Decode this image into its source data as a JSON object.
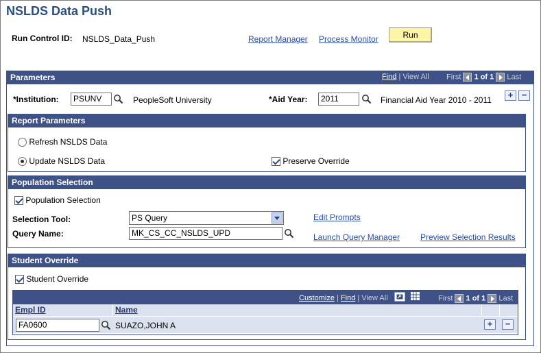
{
  "page": {
    "title": "NSLDS Data Push",
    "run_control_label": "Run Control ID:",
    "run_control_value": "NSLDS_Data_Push",
    "report_manager": "Report Manager",
    "process_monitor": "Process Monitor",
    "run_label": "Run"
  },
  "parameters": {
    "header": "Parameters",
    "nav": {
      "find": "Find",
      "sep": "|",
      "view_all": "View All",
      "first": "First",
      "count": "1 of 1",
      "last": "Last"
    },
    "institution_label": "*Institution:",
    "institution_value": "PSUNV",
    "institution_desc": "PeopleSoft University",
    "aid_year_label": "*Aid Year:",
    "aid_year_value": "2011",
    "aid_year_desc": "Financial Aid Year 2010 - 2011"
  },
  "report_parameters": {
    "header": "Report Parameters",
    "refresh_label": "Refresh NSLDS Data",
    "update_label": "Update NSLDS Data",
    "preserve_label": "Preserve Override"
  },
  "population": {
    "header": "Population Selection",
    "checkbox_label": "Population Selection",
    "tool_label": "Selection Tool:",
    "tool_value": "PS Query",
    "query_label": "Query Name:",
    "query_value": "MK_CS_CC_NSLDS_UPD",
    "edit_prompts": "Edit Prompts",
    "launch_query_manager": "Launch Query Manager",
    "preview_results": "Preview Selection Results"
  },
  "student_override": {
    "header": "Student Override",
    "checkbox_label": "Student Override",
    "grid_nav": {
      "customize": "Customize",
      "sep": "|",
      "find": "Find",
      "view_all": "View All",
      "first": "First",
      "count": "1 of 1",
      "last": "Last"
    },
    "columns": [
      "Empl ID",
      "Name"
    ],
    "rows": [
      {
        "empl_id": "FA0600",
        "name": "SUAZO,JOHN A"
      }
    ]
  },
  "colors": {
    "header_bg": "#3e5288",
    "title": "#2c4e7f",
    "run_button": "#fdf5a6",
    "link": "#2a4da3",
    "grid_row": "#dbe1ee"
  }
}
